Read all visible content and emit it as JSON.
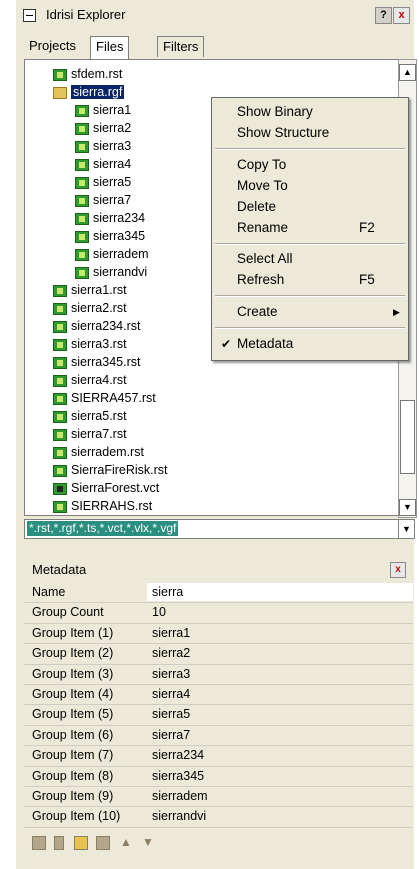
{
  "window": {
    "title": "Idrisi Explorer",
    "help_glyph": "?",
    "close_glyph": "x"
  },
  "tabs": [
    {
      "label": "Projects"
    },
    {
      "label": "Files"
    },
    {
      "label": "Filters"
    }
  ],
  "tree": {
    "items": [
      {
        "label": "sfdem.rst",
        "icon": "raster-file-icon"
      },
      {
        "label": "sierra.rgf",
        "icon": "raster-group-icon"
      },
      {
        "label": "sierra1",
        "icon": "raster-file-icon"
      },
      {
        "label": "sierra2",
        "icon": "raster-file-icon"
      },
      {
        "label": "sierra3",
        "icon": "raster-file-icon"
      },
      {
        "label": "sierra4",
        "icon": "raster-file-icon"
      },
      {
        "label": "sierra5",
        "icon": "raster-file-icon"
      },
      {
        "label": "sierra7",
        "icon": "raster-file-icon"
      },
      {
        "label": "sierra234",
        "icon": "raster-file-icon"
      },
      {
        "label": "sierra345",
        "icon": "raster-file-icon"
      },
      {
        "label": "sierradem",
        "icon": "raster-file-icon"
      },
      {
        "label": "sierrandvi",
        "icon": "raster-file-icon"
      },
      {
        "label": "sierra1.rst",
        "icon": "raster-file-icon"
      },
      {
        "label": "sierra2.rst",
        "icon": "raster-file-icon"
      },
      {
        "label": "sierra234.rst",
        "icon": "raster-file-icon"
      },
      {
        "label": "sierra3.rst",
        "icon": "raster-file-icon"
      },
      {
        "label": "sierra345.rst",
        "icon": "raster-file-icon"
      },
      {
        "label": "sierra4.rst",
        "icon": "raster-file-icon"
      },
      {
        "label": "SIERRA457.rst",
        "icon": "raster-file-icon"
      },
      {
        "label": "sierra5.rst",
        "icon": "raster-file-icon"
      },
      {
        "label": "sierra7.rst",
        "icon": "raster-file-icon"
      },
      {
        "label": "sierradem.rst",
        "icon": "raster-file-icon"
      },
      {
        "label": "SierraFireRisk.rst",
        "icon": "raster-file-icon"
      },
      {
        "label": "SierraForest.vct",
        "icon": "vector-file-icon"
      },
      {
        "label": "SIERRAHS.rst",
        "icon": "raster-file-icon"
      }
    ]
  },
  "filter": {
    "value": "*.rst,*.rgf,*.ts,*.vct,*.vlx,*.vgf"
  },
  "context_menu": {
    "items": [
      {
        "label": "Show Binary",
        "shortcut": "",
        "checked": false,
        "submenu": false
      },
      {
        "label": "Show Structure",
        "shortcut": "",
        "checked": false,
        "submenu": false
      },
      {
        "label": "Copy To",
        "shortcut": "",
        "checked": false,
        "submenu": false
      },
      {
        "label": "Move To",
        "shortcut": "",
        "checked": false,
        "submenu": false
      },
      {
        "label": "Delete",
        "shortcut": "",
        "checked": false,
        "submenu": false
      },
      {
        "label": "Rename",
        "shortcut": "F2",
        "checked": false,
        "submenu": false
      },
      {
        "label": "Select All",
        "shortcut": "",
        "checked": false,
        "submenu": false
      },
      {
        "label": "Refresh",
        "shortcut": "F5",
        "checked": false,
        "submenu": false
      },
      {
        "label": "Create",
        "shortcut": "",
        "checked": false,
        "submenu": true
      },
      {
        "label": "Metadata",
        "shortcut": "",
        "checked": true,
        "submenu": false
      }
    ]
  },
  "metadata": {
    "title": "Metadata",
    "rows": [
      {
        "key": "Name",
        "value": "sierra"
      },
      {
        "key": "Group Count",
        "value": "10"
      },
      {
        "key": "Group Item (1)",
        "value": "sierra1"
      },
      {
        "key": "Group Item (2)",
        "value": "sierra2"
      },
      {
        "key": "Group Item (3)",
        "value": "sierra3"
      },
      {
        "key": "Group Item (4)",
        "value": "sierra4"
      },
      {
        "key": "Group Item (5)",
        "value": "sierra5"
      },
      {
        "key": "Group Item (6)",
        "value": "sierra7"
      },
      {
        "key": "Group Item (7)",
        "value": "sierra234"
      },
      {
        "key": "Group Item (8)",
        "value": "sierra345"
      },
      {
        "key": "Group Item (9)",
        "value": "sierradem"
      },
      {
        "key": "Group Item (10)",
        "value": "sierrandvi"
      }
    ],
    "toolbar": [
      "save-icon",
      "delete-icon",
      "open-folder-icon",
      "folder-icon",
      "move-up-icon",
      "move-down-icon"
    ]
  }
}
